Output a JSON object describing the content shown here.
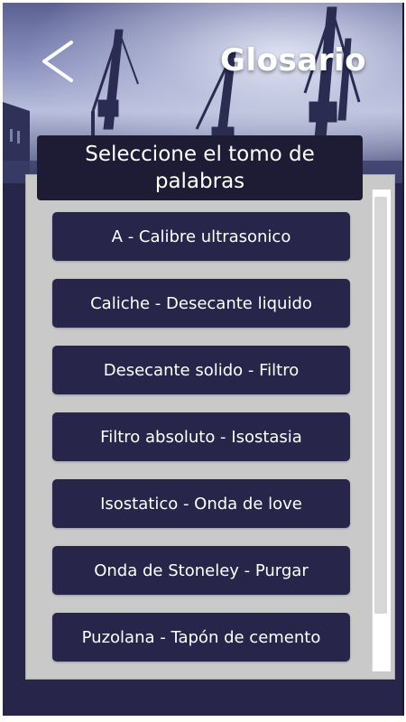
{
  "header": {
    "title": "Glosario",
    "back_icon": "chevron-left-icon"
  },
  "selector": {
    "heading": "Seleccione el tomo de palabras"
  },
  "volumes": [
    {
      "label": "A - Calibre ultrasonico"
    },
    {
      "label": "Caliche - Desecante liquido"
    },
    {
      "label": "Desecante solido - Filtro"
    },
    {
      "label": "Filtro absoluto - Isostasia"
    },
    {
      "label": "Isostatico - Onda de love"
    },
    {
      "label": "Onda de Stoneley - Purgar"
    },
    {
      "label": "Puzolana - Tapón de cemento"
    }
  ],
  "colors": {
    "primary": "#27254a",
    "panel": "#c9c9ca",
    "heading_bg": "#1e1c34",
    "text": "#ffffff"
  }
}
